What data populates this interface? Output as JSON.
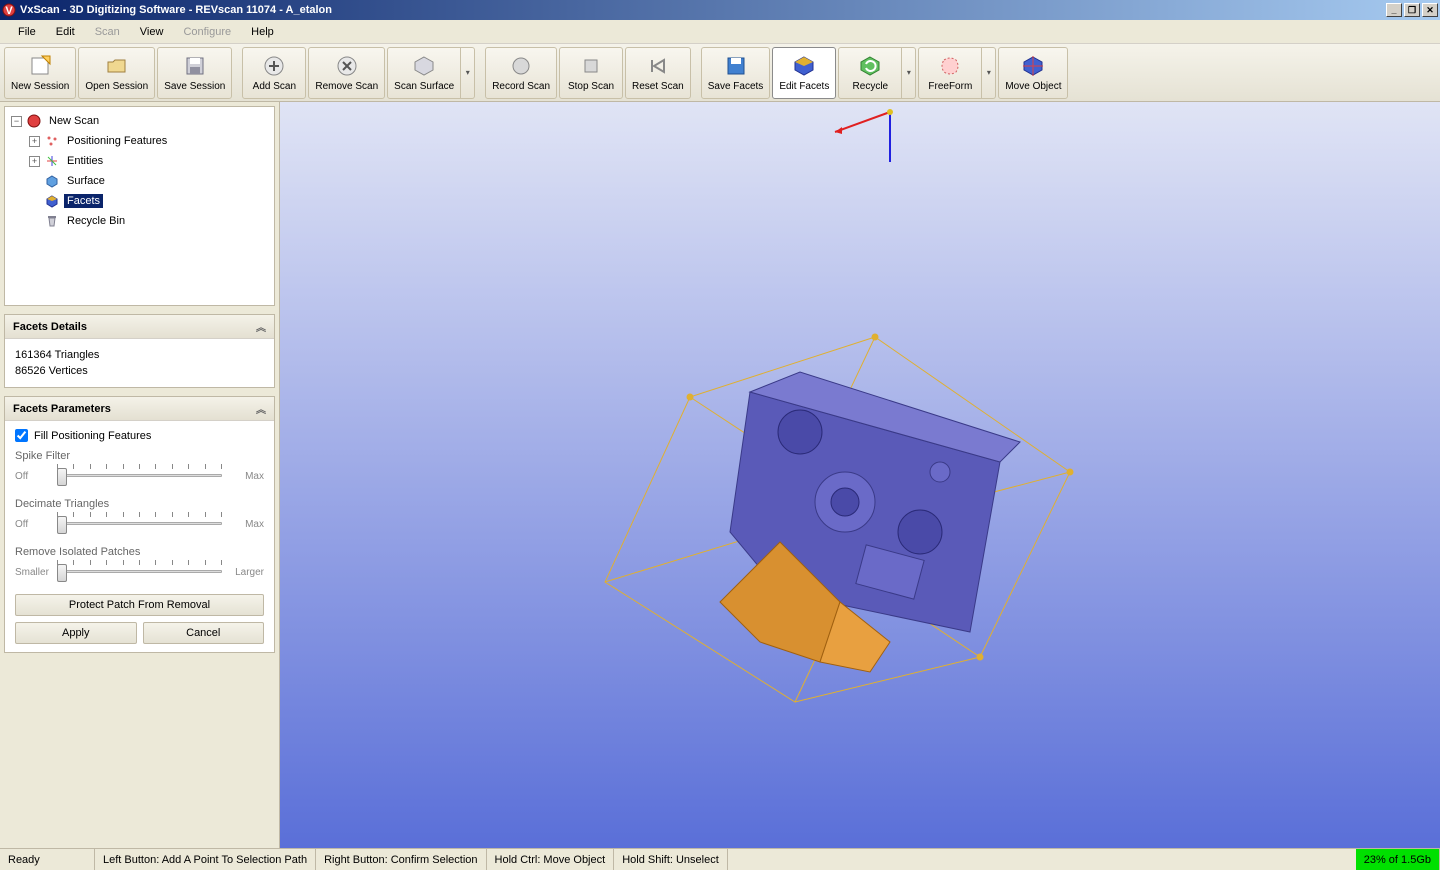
{
  "title": "VxScan - 3D Digitizing Software - REVscan 11074 - A_etalon",
  "menu": {
    "file": "File",
    "edit": "Edit",
    "scan": "Scan",
    "view": "View",
    "configure": "Configure",
    "help": "Help"
  },
  "toolbar": {
    "new_session": "New Session",
    "open_session": "Open Session",
    "save_session": "Save Session",
    "add_scan": "Add Scan",
    "remove_scan": "Remove Scan",
    "scan_surface": "Scan Surface",
    "record_scan": "Record Scan",
    "stop_scan": "Stop Scan",
    "reset_scan": "Reset Scan",
    "save_facets": "Save Facets",
    "edit_facets": "Edit Facets",
    "recycle": "Recycle",
    "freeform": "FreeForm",
    "move_object": "Move Object"
  },
  "tree": {
    "root": "New Scan",
    "positioning": "Positioning Features",
    "entities": "Entities",
    "surface": "Surface",
    "facets": "Facets",
    "recycle_bin": "Recycle Bin"
  },
  "facets_details": {
    "title": "Facets Details",
    "triangles": "161364 Triangles",
    "vertices": "86526 Vertices"
  },
  "facets_params": {
    "title": "Facets Parameters",
    "fill_checkbox": "Fill Positioning Features",
    "spike_filter": "Spike Filter",
    "decimate": "Decimate Triangles",
    "remove_isolated": "Remove Isolated Patches",
    "off": "Off",
    "max": "Max",
    "smaller": "Smaller",
    "larger": "Larger",
    "protect_btn": "Protect Patch From Removal",
    "apply_btn": "Apply",
    "cancel_btn": "Cancel"
  },
  "status": {
    "ready": "Ready",
    "left_button": "Left Button: Add A Point To Selection Path",
    "right_button": "Right Button: Confirm Selection",
    "hold_ctrl": "Hold Ctrl: Move Object",
    "hold_shift": "Hold Shift: Unselect",
    "memory": "23% of 1.5Gb"
  }
}
